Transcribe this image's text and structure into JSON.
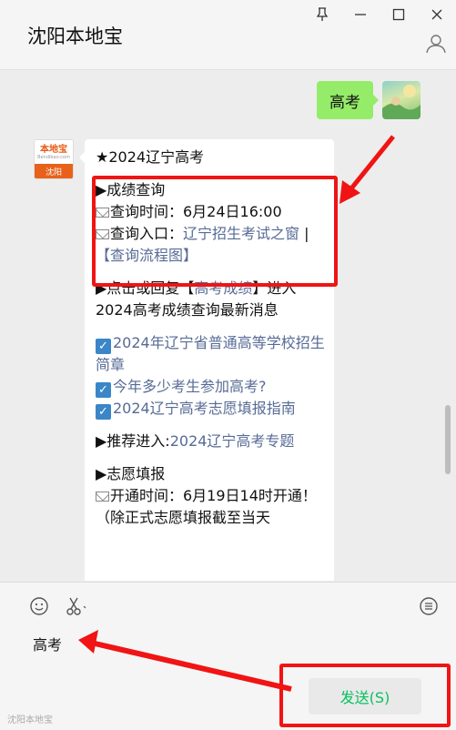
{
  "window": {
    "title": "沈阳本地宝"
  },
  "chat": {
    "sent_message": "高考",
    "sender_avatar": {
      "logo_text": "本地宝",
      "logo_sub": "Bendibao.com",
      "city_label": "沈阳"
    },
    "reply": {
      "line1": "★2024辽宁高考",
      "section1_title": "▶成绩查询",
      "query_time_label": "查询时间：6月24日16:00",
      "query_entry_label": "查询入口：",
      "query_entry_link": "辽宁招生考试之窗",
      "sep": " | ",
      "flow_link": "【查询流程图】",
      "p2_text1": "▶点击或回复【",
      "p2_link": "高考成绩",
      "p2_text2": "】进入2024高考成绩查询最新消息",
      "link_a": "2024年辽宁省普通高等学校招生简章",
      "link_b": "今年多少考生参加高考?",
      "link_c": "2024辽宁高考志愿填报指南",
      "rec_text": "▶推荐进入:",
      "rec_link": "2024辽宁高考专题",
      "section2_title": "▶志愿填报",
      "open_time": "开通时间：6月19日14时开通！（除正式志愿填报截至当天"
    }
  },
  "input": {
    "typed_text": "高考",
    "send_label": "发送(S)"
  },
  "watermark": "沈阳本地宝",
  "colors": {
    "accent_green": "#95ec69",
    "send_text": "#07c160",
    "annotation_red": "#f01414",
    "link": "#576b95"
  }
}
